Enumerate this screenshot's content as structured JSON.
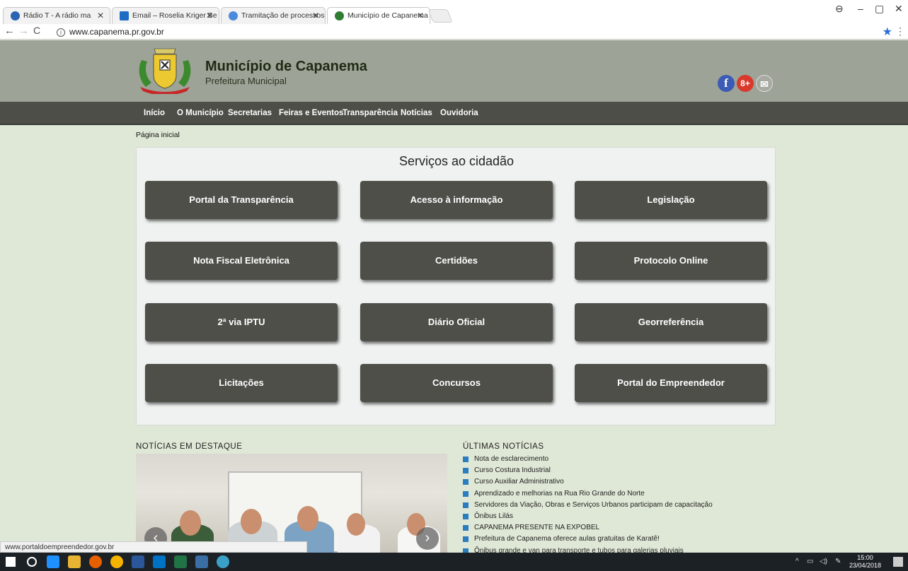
{
  "browser": {
    "tabs": [
      {
        "label": "Rádio T - A rádio ma",
        "fav_color": "#2a63b4"
      },
      {
        "label": "Email – Roselia Kriger Be",
        "fav_color": "#1f6cc4"
      },
      {
        "label": "Tramitação de processos",
        "fav_color": "#4a89dc"
      },
      {
        "label": "Município de Capanema",
        "fav_color": "#2f7d32"
      }
    ],
    "url": "www.capanema.pr.gov.br",
    "status_url": "www.portaldoempreendedor.gov.br"
  },
  "site": {
    "title": "Município de Capanema",
    "subtitle": "Prefeitura Municipal",
    "social": {
      "facebook": "f",
      "gplus": "8+",
      "email": "✉"
    },
    "nav": [
      "Início",
      "O Município",
      "Secretarias",
      "Feiras e Eventos",
      "Transparência",
      "Notícias",
      "Ouvidoria"
    ],
    "breadcrumb": "Página inicial"
  },
  "services": {
    "title": "Serviços ao cidadão",
    "items": [
      "Portal da Transparência",
      "Acesso à informação",
      "Legislação",
      "Nota Fiscal Eletrônica",
      "Certidões",
      "Protocolo Online",
      "2ª via IPTU",
      "Diário Oficial",
      "Georreferência",
      "Licitações",
      "Concursos",
      "Portal do Empreendedor"
    ]
  },
  "featured": {
    "title": "NOTÍCIAS EM DESTAQUE"
  },
  "latest": {
    "title": "ÚLTIMAS NOTÍCIAS",
    "items": [
      "Nota de esclarecimento",
      "Curso Costura Industrial",
      "Curso Auxiliar Administrativo",
      "Aprendizado e melhorias na Rua Rio Grande do Norte",
      "Servidores da Viação, Obras e Serviços Urbanos participam de capacitação",
      "Ônibus Lilás",
      "CAPANEMA PRESENTE NA EXPOBEL",
      "Prefeitura de Capanema oferece aulas gratuitas de Karatê!",
      "Ônibus grande e van para transporte e tubos para galerias pluviais"
    ]
  },
  "taskbar": {
    "time": "15:00",
    "date": "23/04/2018"
  }
}
